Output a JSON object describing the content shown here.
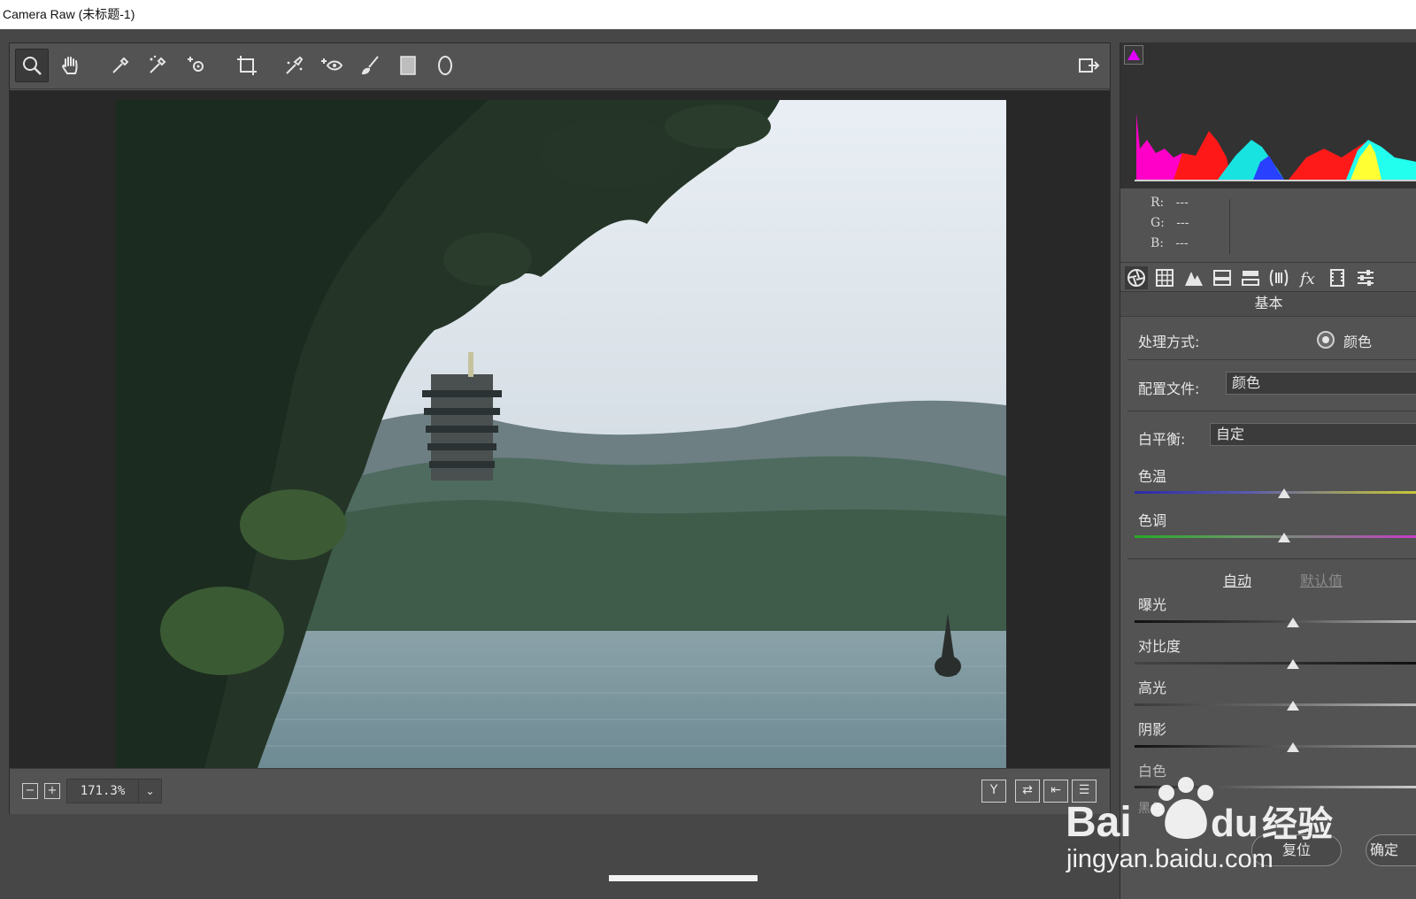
{
  "window": {
    "title": "Camera Raw (未标题-1)"
  },
  "toolbar": {
    "tools": [
      "zoom-icon",
      "hand-icon",
      "white-balance-icon",
      "color-sampler-icon",
      "targeted-adjust-icon",
      "crop-icon",
      "spot-removal-icon",
      "red-eye-icon",
      "adjustment-brush-icon",
      "graduated-filter-icon",
      "radial-filter-icon"
    ],
    "export_icon": "open-object-icon"
  },
  "histogram": {
    "rgb_r_label": "R:",
    "rgb_g_label": "G:",
    "rgb_b_label": "B:",
    "rgb_r_value": "---",
    "rgb_g_value": "---",
    "rgb_b_value": "---",
    "clip_color": "#e000ff"
  },
  "panel_tabs": [
    "aperture-icon",
    "grid-icon",
    "mountains-icon",
    "split-icon",
    "bars-icon",
    "lens-icon",
    "fx-icon",
    "film-icon",
    "sliders-icon"
  ],
  "panel": {
    "title": "基本",
    "treatment_label": "处理方式:",
    "treatment_option": "颜色",
    "profile_label": "配置文件:",
    "profile_value": "颜色",
    "wb_label": "白平衡:",
    "wb_value": "自定",
    "temp_label": "色温",
    "tint_label": "色调",
    "auto_link": "自动",
    "default_link": "默认值",
    "exposure_label": "曝光",
    "contrast_label": "对比度",
    "highlights_label": "高光",
    "shadows_label": "阴影",
    "whites_label": "白色",
    "blacks_label": "黑色",
    "sliders": {
      "temp": 0.53,
      "tint": 0.53,
      "exposure": 0.56,
      "contrast": 0.56,
      "highlights": 0.56,
      "shadows": 0.56
    }
  },
  "status": {
    "zoom_out": "−",
    "zoom_in": "+",
    "zoom_value": "171.3%",
    "view_btn_y": "Y",
    "view_btn_swap": "⇄",
    "view_btn_left": "⇤",
    "view_btn_settings": "☰"
  },
  "footer": {
    "reset": "复位",
    "done": "确定"
  },
  "watermark": {
    "text": "Bai du 经验",
    "url": "jingyan.baidu.com"
  }
}
